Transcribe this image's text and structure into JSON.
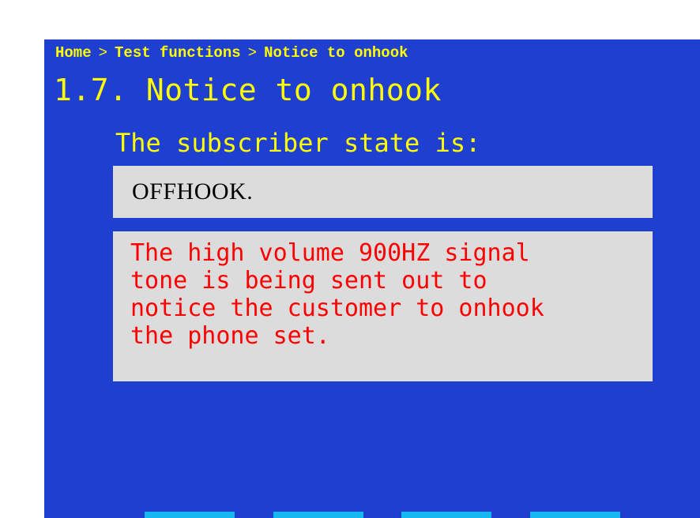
{
  "breadcrumb": {
    "items": [
      "Home",
      "Test functions",
      "Notice to onhook"
    ],
    "separator": ">"
  },
  "page": {
    "title": "1.7. Notice to onhook"
  },
  "subscriber": {
    "label": "The subscriber state is:",
    "state": "OFFHOOK."
  },
  "message": {
    "text": "The high volume 900HZ signal\ntone is being sent out to\nnotice the customer to onhook\nthe phone set."
  },
  "colors": {
    "screen_background": "#1f3fd0",
    "header_text": "#ffff00",
    "panel_background": "#dcdcdc",
    "state_text": "#000000",
    "message_text": "#ff0000",
    "softkey": "#16b8ef"
  },
  "softkeys": [
    "",
    "",
    "",
    ""
  ]
}
